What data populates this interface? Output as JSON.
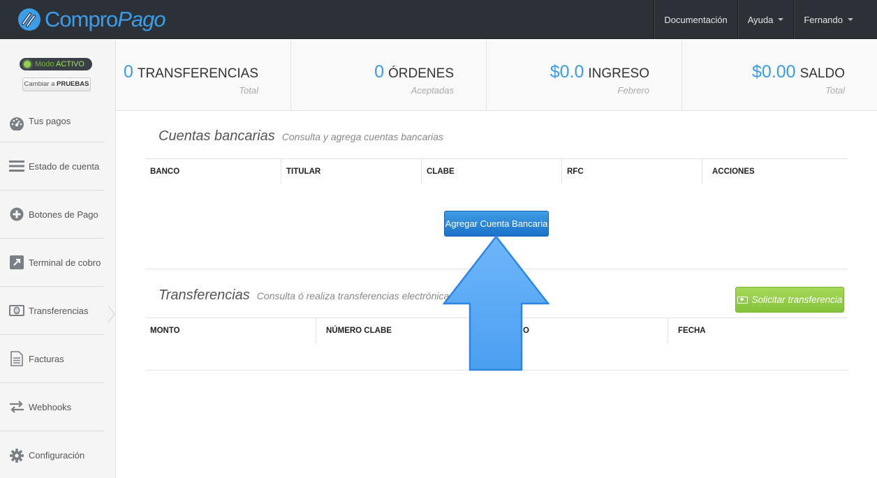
{
  "brand": {
    "part1": "Compro",
    "part2": "Pago"
  },
  "topnav": {
    "docs": "Documentación",
    "help": "Ayuda",
    "user": "Fernando"
  },
  "mode": {
    "label": "Modo",
    "status": "ACTIVO",
    "switch_prefix": "Cambiar a",
    "switch_target": "PRUEBAS"
  },
  "sidebar": {
    "items": [
      {
        "label": "Tus pagos",
        "icon": "dashboard-icon"
      },
      {
        "label": "Estado de cuenta",
        "icon": "list-icon"
      },
      {
        "label": "Botones de Pago",
        "icon": "plus-circle-icon"
      },
      {
        "label": "Terminal de cobro",
        "icon": "external-link-icon"
      },
      {
        "label": "Transferencias",
        "icon": "money-icon"
      },
      {
        "label": "Facturas",
        "icon": "document-icon"
      },
      {
        "label": "Webhooks",
        "icon": "exchange-icon"
      },
      {
        "label": "Configuración",
        "icon": "gear-icon"
      }
    ],
    "active": "Transferencias"
  },
  "stats": [
    {
      "value": "0",
      "label": "TRANSFERENCIAS",
      "sub": "Total"
    },
    {
      "value": "0",
      "label": "ÓRDENES",
      "sub": "Aceptadas"
    },
    {
      "value": "$0.0",
      "label": "INGRESO",
      "sub": "Febrero"
    },
    {
      "value": "$0.00",
      "label": "SALDO",
      "sub": "Total"
    }
  ],
  "accounts": {
    "title": "Cuentas bancarias",
    "subtitle": "Consulta y agrega cuentas bancarias",
    "columns": [
      "BANCO",
      "TITULAR",
      "CLABE",
      "RFC",
      "ACCIONES"
    ],
    "add_button": "Agregar Cuenta Bancaria"
  },
  "transfers": {
    "title": "Transferencias",
    "subtitle": "Consulta ó realiza transferencias electrónicas",
    "columns": [
      "MONTO",
      "NÚMERO CLABE",
      "O",
      "FECHA"
    ],
    "request_button": "Solicitar transferencia"
  },
  "colors": {
    "accent": "#3d9ce8",
    "topbar": "#2c3138",
    "success": "#8cc63f",
    "arrow": "#5aa9f5"
  }
}
